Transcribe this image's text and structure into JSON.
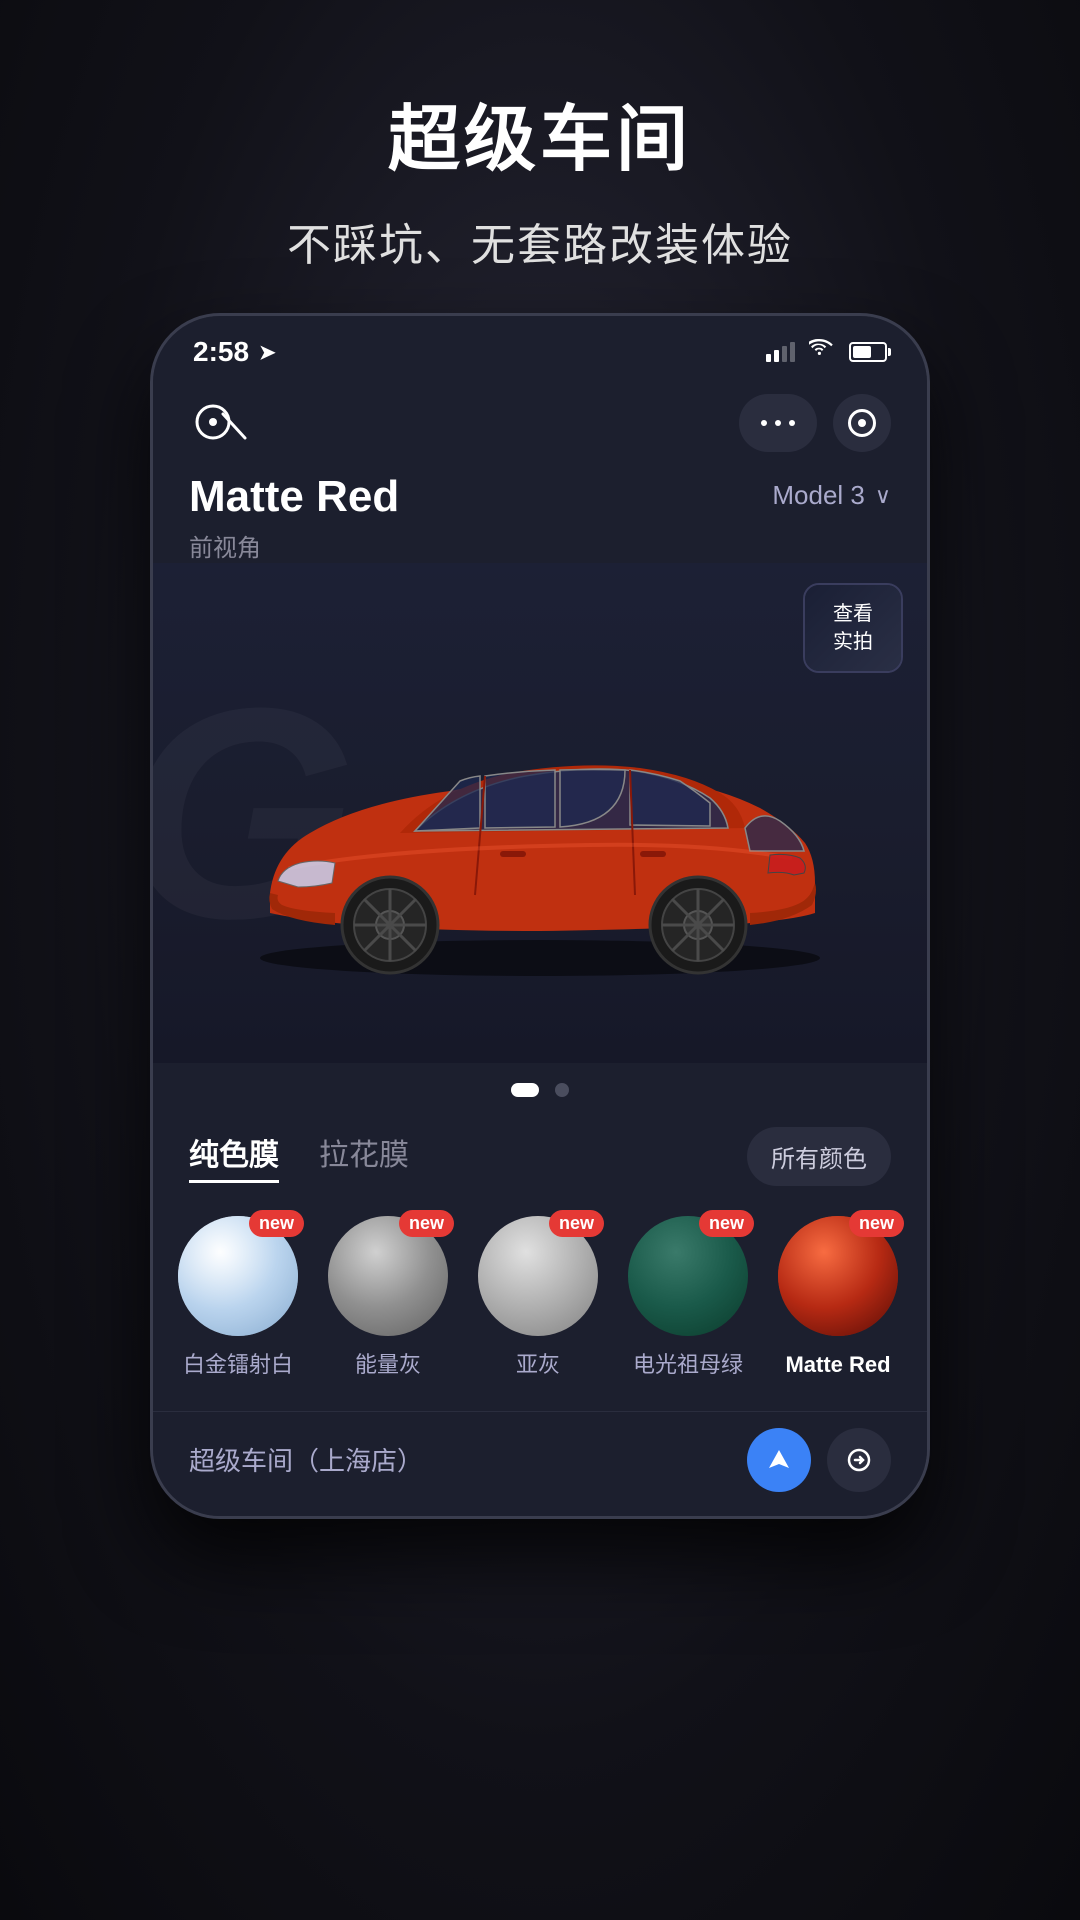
{
  "marketing": {
    "title": "超级车间",
    "subtitle": "不踩坑、无套路改装体验"
  },
  "status_bar": {
    "time": "2:58",
    "location_icon": "▷"
  },
  "header": {
    "more_dots": "···",
    "target_icon": "◎"
  },
  "car": {
    "name": "Matte Red",
    "angle": "前视角",
    "model": "Model 3",
    "model_chevron": "⌄"
  },
  "real_photo_btn": {
    "line1": "查看",
    "line2": "实拍"
  },
  "page_dots": [
    {
      "active": true
    },
    {
      "active": false
    }
  ],
  "tabs": {
    "tab1": "纯色膜",
    "tab2": "拉花膜",
    "all_colors": "所有颜色"
  },
  "swatches": [
    {
      "id": 1,
      "label": "白金镭射白",
      "type": "white",
      "is_new": true,
      "is_active": false
    },
    {
      "id": 2,
      "label": "能量灰",
      "type": "gray-energy",
      "is_new": true,
      "is_active": false
    },
    {
      "id": 3,
      "label": "亚灰",
      "type": "gray-sub",
      "is_new": true,
      "is_active": false
    },
    {
      "id": 4,
      "label": "电光祖母绿",
      "type": "green",
      "is_new": true,
      "is_active": false
    },
    {
      "id": 5,
      "label": "Matte Red",
      "type": "red",
      "is_new": true,
      "is_active": true
    }
  ],
  "new_label": "new",
  "bottom": {
    "shop_name": "超级车间（上海店）"
  }
}
